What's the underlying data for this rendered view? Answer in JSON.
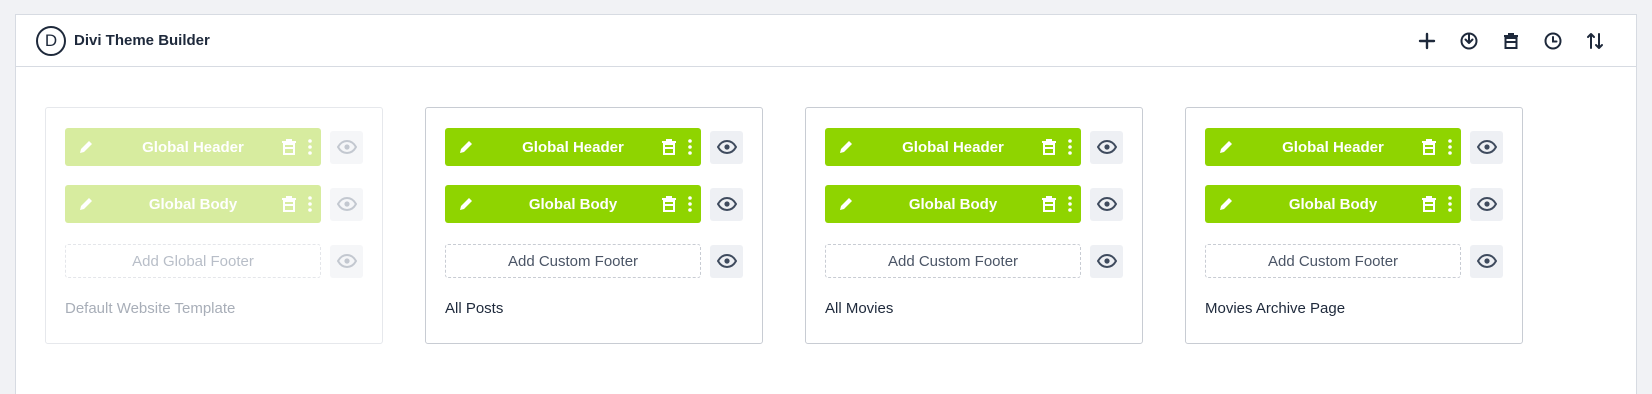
{
  "app": {
    "logo_letter": "D",
    "title": "Divi Theme Builder"
  },
  "toolbar": [
    "add-icon",
    "portability-icon",
    "trash-icon",
    "history-icon",
    "sort-icon"
  ],
  "colors": {
    "accent": "#8fd400",
    "accent_disabled": "#d7ec9f",
    "icon": "#3f4b5e"
  },
  "templates": [
    {
      "title": "Default Website Template",
      "disabled": true,
      "header": "Global Header",
      "body": "Global Body",
      "footer_placeholder": "Add Global Footer"
    },
    {
      "title": "All Posts",
      "disabled": false,
      "header": "Global Header",
      "body": "Global Body",
      "footer_placeholder": "Add Custom Footer"
    },
    {
      "title": "All Movies",
      "disabled": false,
      "header": "Global Header",
      "body": "Global Body",
      "footer_placeholder": "Add Custom Footer"
    },
    {
      "title": "Movies Archive Page",
      "disabled": false,
      "header": "Global Header",
      "body": "Global Body",
      "footer_placeholder": "Add Custom Footer"
    }
  ]
}
